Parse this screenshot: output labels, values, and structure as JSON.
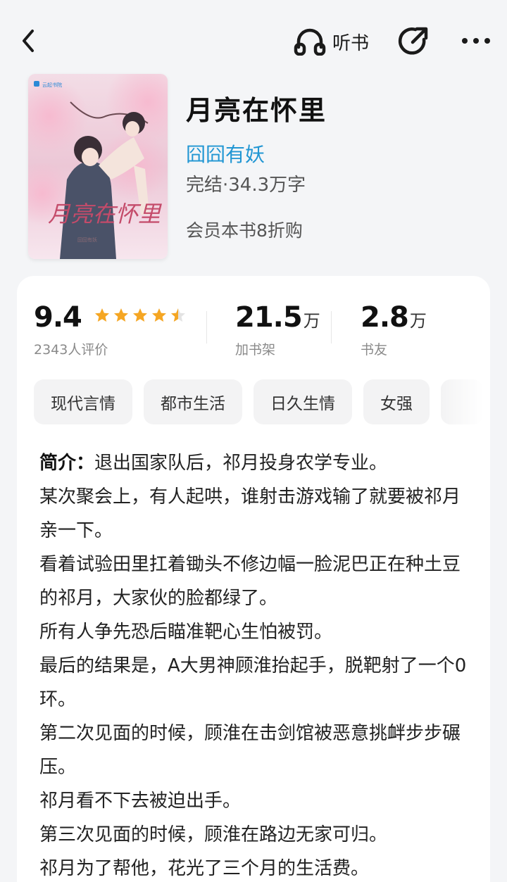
{
  "topbar": {
    "back_icon": "chevron-left-icon",
    "listen_label": "听书",
    "listen_icon": "headphones-icon",
    "share_icon": "share-icon",
    "more_icon": "more-dots-icon"
  },
  "book": {
    "title": "月亮在怀里",
    "author": "囧囧有妖",
    "status": "完结·34.3万字",
    "promo": "会员本书8折购",
    "cover_title": "月亮在怀里",
    "cover_publisher": "云起书院"
  },
  "stats": {
    "rating": "9.4",
    "rating_stars": 4.5,
    "rating_count": "2343人评价",
    "shelf_num": "21.5",
    "shelf_unit": "万",
    "shelf_label": "加书架",
    "fans_num": "2.8",
    "fans_unit": "万",
    "fans_label": "书友"
  },
  "tags": [
    "现代言情",
    "都市生活",
    "日久生情",
    "女强"
  ],
  "intro": {
    "lead": "简介：",
    "first": "退出国家队后，祁月投身农学专业。",
    "lines": [
      "某次聚会上，有人起哄，谁射击游戏输了就要被祁月亲一下。",
      "看着试验田里扛着锄头不修边幅一脸泥巴正在种土豆的祁月，大家伙的脸都绿了。",
      "所有人争先恐后瞄准靶心生怕被罚。",
      "最后的结果是，A大男神顾淮抬起手，脱靶射了一个0环。",
      "第二次见面的时候，顾淮在击剑馆被恶意挑衅步步碾压。",
      "祁月看不下去被迫出手。",
      "第三次见面的时候，顾淮在路边无家可归。",
      "祁月为了帮他，花光了三个月的生活费。"
    ]
  },
  "colors": {
    "accent_blue": "#2196d3",
    "star": "#f5a623",
    "background": "#f4f5f7"
  }
}
